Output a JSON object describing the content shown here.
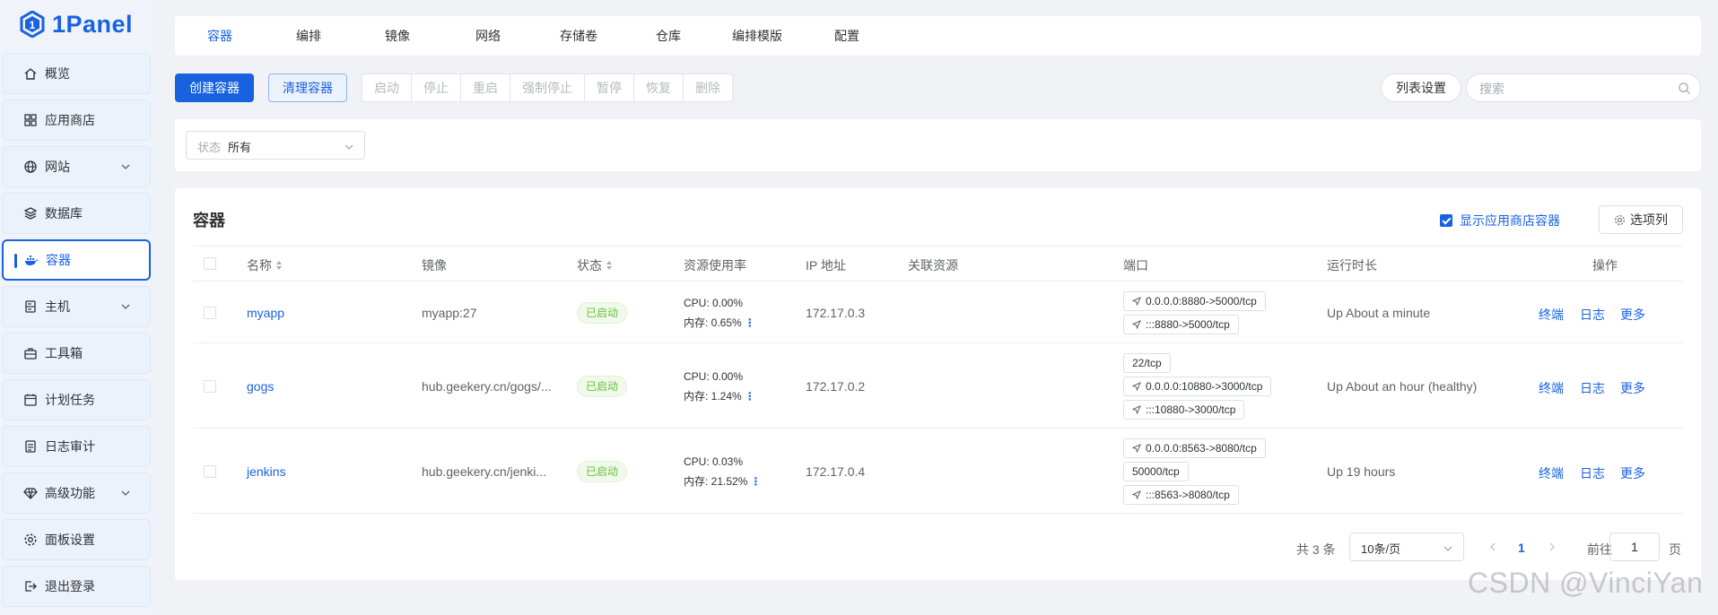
{
  "app": {
    "name": "1Panel",
    "brand_color": "#1862e0"
  },
  "sidebar": {
    "items": [
      {
        "label": "概览",
        "icon": "home-icon"
      },
      {
        "label": "应用商店",
        "icon": "grid-icon"
      },
      {
        "label": "网站",
        "icon": "globe-icon",
        "expandable": true
      },
      {
        "label": "数据库",
        "icon": "layers-icon"
      },
      {
        "label": "容器",
        "icon": "docker-icon",
        "active": true
      },
      {
        "label": "主机",
        "icon": "server-icon",
        "expandable": true
      },
      {
        "label": "工具箱",
        "icon": "toolbox-icon"
      },
      {
        "label": "计划任务",
        "icon": "calendar-icon"
      },
      {
        "label": "日志审计",
        "icon": "log-icon"
      },
      {
        "label": "高级功能",
        "icon": "diamond-icon",
        "expandable": true
      },
      {
        "label": "面板设置",
        "icon": "gear-icon"
      },
      {
        "label": "退出登录",
        "icon": "logout-icon"
      }
    ]
  },
  "tabs": [
    "容器",
    "编排",
    "镜像",
    "网络",
    "存储卷",
    "仓库",
    "编排模版",
    "配置"
  ],
  "toolbar": {
    "create": "创建容器",
    "prune": "清理容器",
    "group": [
      "启动",
      "停止",
      "重启",
      "强制停止",
      "暂停",
      "恢复",
      "删除"
    ],
    "list_settings": "列表设置",
    "search_placeholder": "搜索"
  },
  "filter": {
    "prefix": "状态",
    "value": "所有"
  },
  "card": {
    "title": "容器",
    "show_app_containers": "显示应用商店容器",
    "columns_button": "选项列"
  },
  "table": {
    "headers": {
      "name": "名称",
      "image": "镜像",
      "state": "状态",
      "usage": "资源使用率",
      "ip": "IP 地址",
      "related": "关联资源",
      "ports": "端口",
      "uptime": "运行时长",
      "ops": "操作"
    },
    "rows": [
      {
        "name": "myapp",
        "image": "myapp:27",
        "state": "已启动",
        "cpu": "CPU: 0.00%",
        "mem": "内存: 0.65%",
        "ip": "172.17.0.3",
        "ports": [
          {
            "text": "0.0.0.0:8880->5000/tcp",
            "arrow": true
          },
          {
            "text": ":::8880->5000/tcp",
            "arrow": true
          }
        ],
        "uptime": "Up About a minute"
      },
      {
        "name": "gogs",
        "image": "hub.geekery.cn/gogs/...",
        "state": "已启动",
        "cpu": "CPU: 0.00%",
        "mem": "内存: 1.24%",
        "ip": "172.17.0.2",
        "ports": [
          {
            "text": "22/tcp",
            "arrow": false
          },
          {
            "text": "0.0.0.0:10880->3000/tcp",
            "arrow": true
          },
          {
            "text": ":::10880->3000/tcp",
            "arrow": true
          }
        ],
        "uptime": "Up About an hour (healthy)"
      },
      {
        "name": "jenkins",
        "image": "hub.geekery.cn/jenki...",
        "state": "已启动",
        "cpu": "CPU: 0.03%",
        "mem": "内存: 21.52%",
        "ip": "172.17.0.4",
        "ports": [
          {
            "text": "0.0.0.0:8563->8080/tcp",
            "arrow": true
          },
          {
            "text": "50000/tcp",
            "arrow": false
          },
          {
            "text": ":::8563->8080/tcp",
            "arrow": true
          }
        ],
        "uptime": "Up 19 hours"
      }
    ],
    "ops": [
      "终端",
      "日志",
      "更多"
    ]
  },
  "pagination": {
    "total": "共 3 条",
    "page_size": "10条/页",
    "current_page": "1",
    "goto_label": "前往",
    "goto_value": "1",
    "page_unit": "页"
  },
  "watermark": "CSDN @VinciYan"
}
